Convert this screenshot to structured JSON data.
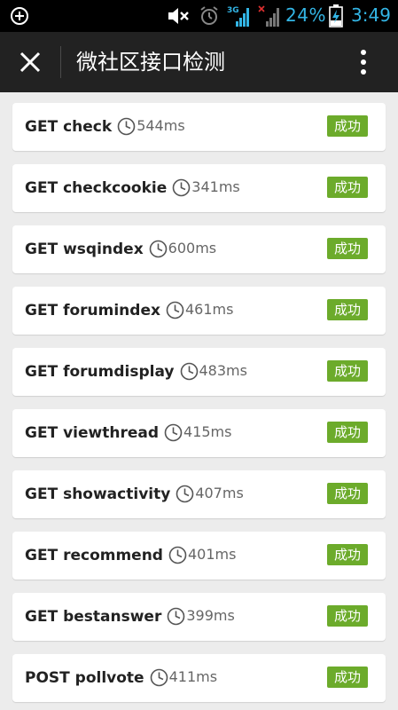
{
  "status_bar": {
    "battery_percent": "24%",
    "time": "3:49",
    "network_label": "3G",
    "accent_color": "#33b5e5"
  },
  "action_bar": {
    "title": "微社区接口检测",
    "close_icon": "close-icon",
    "overflow_icon": "overflow-menu-icon"
  },
  "results": [
    {
      "method": "GET check",
      "time": "544ms",
      "status": "成功"
    },
    {
      "method": "GET checkcookie",
      "time": "341ms",
      "status": "成功"
    },
    {
      "method": "GET wsqindex",
      "time": "600ms",
      "status": "成功"
    },
    {
      "method": "GET forumindex",
      "time": "461ms",
      "status": "成功"
    },
    {
      "method": "GET forumdisplay",
      "time": "483ms",
      "status": "成功"
    },
    {
      "method": "GET viewthread",
      "time": "415ms",
      "status": "成功"
    },
    {
      "method": "GET showactivity",
      "time": "407ms",
      "status": "成功"
    },
    {
      "method": "GET recommend",
      "time": "401ms",
      "status": "成功"
    },
    {
      "method": "GET bestanswer",
      "time": "399ms",
      "status": "成功"
    },
    {
      "method": "POST pollvote",
      "time": "411ms",
      "status": "成功"
    }
  ],
  "colors": {
    "success_badge": "#6cab2b",
    "action_bar": "#222222",
    "background": "#ececec"
  }
}
